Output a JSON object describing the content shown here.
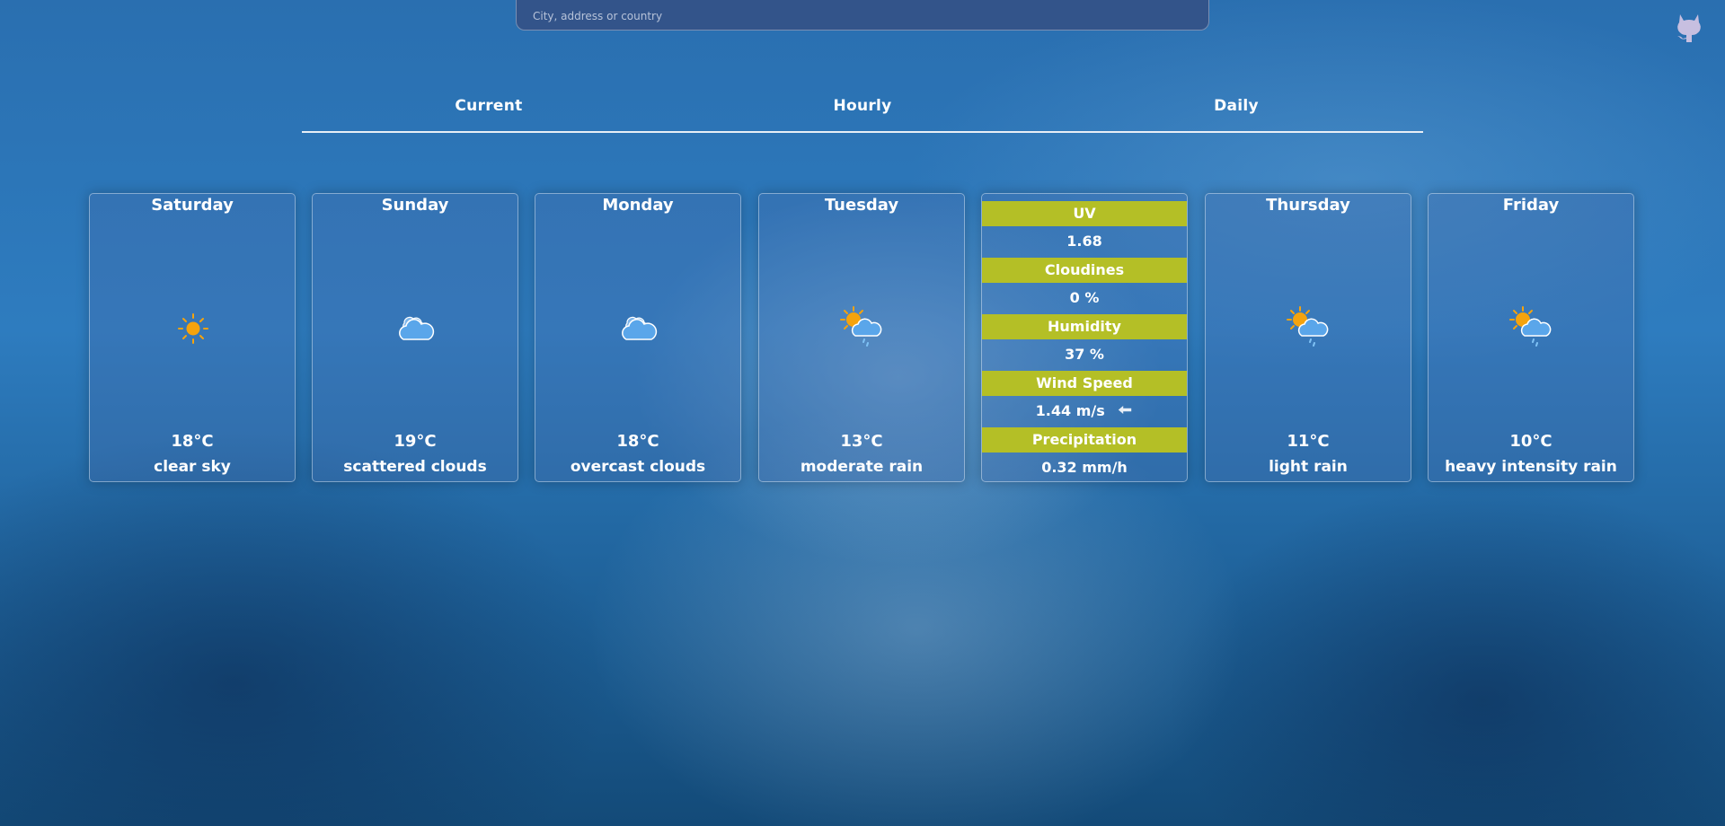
{
  "search": {
    "placeholder": "City, address or country"
  },
  "tabs": [
    {
      "label": "Current"
    },
    {
      "label": "Hourly"
    },
    {
      "label": "Daily"
    }
  ],
  "days": [
    {
      "name": "Saturday",
      "temp": "18°C",
      "desc": "clear sky",
      "icon": "sun-icon"
    },
    {
      "name": "Sunday",
      "temp": "19°C",
      "desc": "scattered clouds",
      "icon": "clouds-icon"
    },
    {
      "name": "Monday",
      "temp": "18°C",
      "desc": "overcast clouds",
      "icon": "clouds-icon"
    },
    {
      "name": "Tuesday",
      "temp": "13°C",
      "desc": "moderate rain",
      "icon": "sun-rain-icon"
    },
    {
      "name": "Thursday",
      "temp": "11°C",
      "desc": "light rain",
      "icon": "sun-rain-icon"
    },
    {
      "name": "Friday",
      "temp": "10°C",
      "desc": "heavy intensity rain",
      "icon": "sun-rain-icon"
    }
  ],
  "details": {
    "uv_label": "UV",
    "uv_value": "1.68",
    "cloud_label": "Cloudines",
    "cloud_value": "0 %",
    "humidity_label": "Humidity",
    "humidity_value": "37 %",
    "wind_label": "Wind Speed",
    "wind_value": "1.44 m/s",
    "precip_label": "Precipitation",
    "precip_value": "0.32 mm/h"
  },
  "colors": {
    "detail_header": "#b4bf26",
    "sun": "#f5a30d",
    "cloud": "#5aa6ea"
  }
}
